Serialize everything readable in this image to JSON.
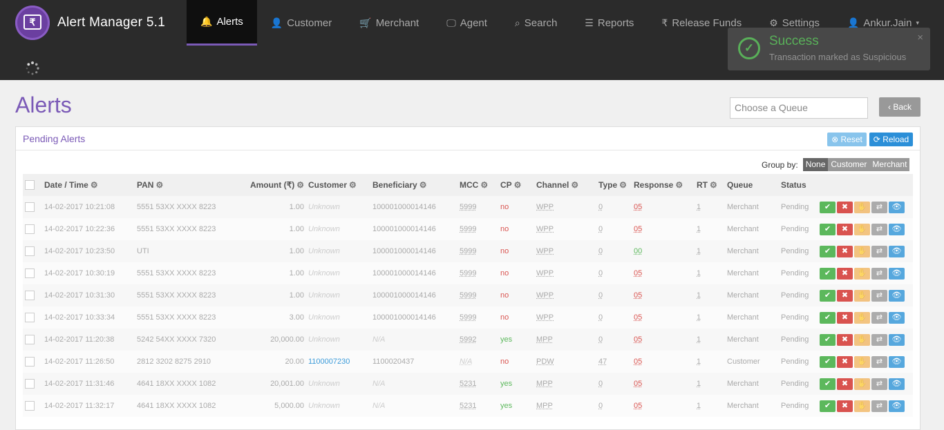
{
  "app": {
    "title": "Alert Manager 5.1",
    "logo_symbol": "₹"
  },
  "nav": [
    {
      "label": "Alerts",
      "icon": "bell-icon",
      "glyph": "🔔",
      "active": true
    },
    {
      "label": "Customer",
      "icon": "user-icon",
      "glyph": "👤"
    },
    {
      "label": "Merchant",
      "icon": "cart-icon",
      "glyph": "🛒"
    },
    {
      "label": "Agent",
      "icon": "monitor-icon",
      "glyph": "🖵"
    },
    {
      "label": "Search",
      "icon": "search-icon",
      "glyph": "⌕"
    },
    {
      "label": "Reports",
      "icon": "list-icon",
      "glyph": "☰"
    },
    {
      "label": "Release Funds",
      "icon": "rupee-icon",
      "glyph": "₹"
    },
    {
      "label": "Settings",
      "icon": "gear-icon",
      "glyph": "⚙"
    },
    {
      "label": "Ankur.Jain",
      "icon": "user-icon",
      "glyph": "👤",
      "caret": "▾"
    }
  ],
  "toast": {
    "title": "Success",
    "message": "Transaction marked as Suspicious",
    "close": "×",
    "check": "✓"
  },
  "page": {
    "title": "Alerts",
    "queue_placeholder": "Choose a Queue",
    "back_label": "Back",
    "back_glyph": "‹"
  },
  "panel": {
    "title": "Pending Alerts",
    "reset_label": "Reset",
    "reload_label": "Reload",
    "groupby_label": "Group by:",
    "groupby_options": [
      "None",
      "Customer",
      "Merchant"
    ],
    "groupby_selected": "None"
  },
  "columns": [
    "Date / Time",
    "PAN",
    "Amount (₹)",
    "Customer",
    "Beneficiary",
    "MCC",
    "CP",
    "Channel",
    "Type",
    "Response",
    "RT",
    "Queue",
    "Status"
  ],
  "rows": [
    {
      "dt": "14-02-2017 10:21:08",
      "pan": "5551 53XX XXXX 8223",
      "amount": "1.00",
      "customer": "Unknown",
      "beneficiary": "100001000014146",
      "mcc": "5999",
      "cp": "no",
      "channel": "WPP",
      "type": "0",
      "response": "05",
      "rt": "1",
      "queue": "Merchant",
      "status": "Pending"
    },
    {
      "dt": "14-02-2017 10:22:36",
      "pan": "5551 53XX XXXX 8223",
      "amount": "1.00",
      "customer": "Unknown",
      "beneficiary": "100001000014146",
      "mcc": "5999",
      "cp": "no",
      "channel": "WPP",
      "type": "0",
      "response": "05",
      "rt": "1",
      "queue": "Merchant",
      "status": "Pending"
    },
    {
      "dt": "14-02-2017 10:23:50",
      "pan": "UTI",
      "amount": "1.00",
      "customer": "Unknown",
      "beneficiary": "100001000014146",
      "mcc": "5999",
      "cp": "no",
      "channel": "WPP",
      "type": "0",
      "response": "00",
      "rt": "1",
      "queue": "Merchant",
      "status": "Pending"
    },
    {
      "dt": "14-02-2017 10:30:19",
      "pan": "5551 53XX XXXX 8223",
      "amount": "1.00",
      "customer": "Unknown",
      "beneficiary": "100001000014146",
      "mcc": "5999",
      "cp": "no",
      "channel": "WPP",
      "type": "0",
      "response": "05",
      "rt": "1",
      "queue": "Merchant",
      "status": "Pending"
    },
    {
      "dt": "14-02-2017 10:31:30",
      "pan": "5551 53XX XXXX 8223",
      "amount": "1.00",
      "customer": "Unknown",
      "beneficiary": "100001000014146",
      "mcc": "5999",
      "cp": "no",
      "channel": "WPP",
      "type": "0",
      "response": "05",
      "rt": "1",
      "queue": "Merchant",
      "status": "Pending"
    },
    {
      "dt": "14-02-2017 10:33:34",
      "pan": "5551 53XX XXXX 8223",
      "amount": "3.00",
      "customer": "Unknown",
      "beneficiary": "100001000014146",
      "mcc": "5999",
      "cp": "no",
      "channel": "WPP",
      "type": "0",
      "response": "05",
      "rt": "1",
      "queue": "Merchant",
      "status": "Pending"
    },
    {
      "dt": "14-02-2017 11:20:38",
      "pan": "5242 54XX XXXX 7320",
      "amount": "20,000.00",
      "customer": "Unknown",
      "beneficiary": "N/A",
      "mcc": "5992",
      "cp": "yes",
      "channel": "MPP",
      "type": "0",
      "response": "05",
      "rt": "1",
      "queue": "Merchant",
      "status": "Pending"
    },
    {
      "dt": "14-02-2017 11:26:50",
      "pan": "2812 3202 8275 2910",
      "amount": "20.00",
      "customer": "1100007230",
      "beneficiary": "1100020437",
      "mcc": "N/A",
      "cp": "no",
      "channel": "PDW",
      "type": "47",
      "response": "05",
      "rt": "1",
      "queue": "Customer",
      "status": "Pending"
    },
    {
      "dt": "14-02-2017 11:31:46",
      "pan": "4641 18XX XXXX 1082",
      "amount": "20,001.00",
      "customer": "Unknown",
      "beneficiary": "N/A",
      "mcc": "5231",
      "cp": "yes",
      "channel": "MPP",
      "type": "0",
      "response": "05",
      "rt": "1",
      "queue": "Merchant",
      "status": "Pending"
    },
    {
      "dt": "14-02-2017 11:32:17",
      "pan": "4641 18XX XXXX 1082",
      "amount": "5,000.00",
      "customer": "Unknown",
      "beneficiary": "N/A",
      "mcc": "5231",
      "cp": "yes",
      "channel": "MPP",
      "type": "0",
      "response": "05",
      "rt": "1",
      "queue": "Merchant",
      "status": "Pending"
    }
  ],
  "actions": [
    {
      "name": "approve-button",
      "glyph": "✔",
      "cls": "ok"
    },
    {
      "name": "reject-button",
      "glyph": "✖",
      "cls": "no"
    },
    {
      "name": "flag-button",
      "glyph": "✋",
      "cls": "fl"
    },
    {
      "name": "transfer-button",
      "glyph": "⇄",
      "cls": "tr"
    },
    {
      "name": "view-button",
      "glyph": "👁",
      "cls": "vw"
    }
  ]
}
